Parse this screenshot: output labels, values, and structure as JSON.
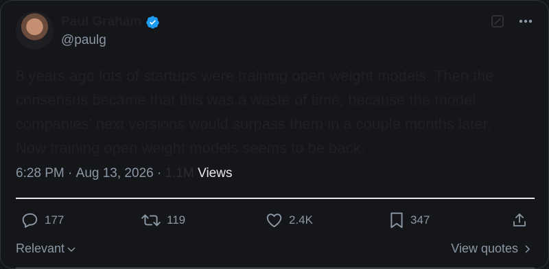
{
  "author": {
    "display_name": "Paul Graham",
    "handle": "@paulg"
  },
  "tweet": {
    "text": "8 years ago lots of startups were training open weight models. Then the consensus became that this was a waste of time, because the model companies' next versions would surpass them in a couple months later. Now training open weight models seems to be back."
  },
  "meta": {
    "time": "6:28 PM",
    "sep1": " · ",
    "date": "Aug 13, 2026",
    "sep2": " · ",
    "views_count": "1.1M",
    "views_label": " Views"
  },
  "actions": {
    "replies": "177",
    "reposts": "119",
    "likes": "2.4K",
    "bookmarks": "347"
  },
  "footer": {
    "relevant": "Relevant",
    "view_quotes": "View quotes"
  },
  "colors": {
    "background": "#15161a",
    "verified": "#1d9bf0",
    "muted_text": "#8b98a5",
    "primary_text": "#e7e9ea"
  },
  "icons": [
    "verified-badge-icon",
    "grok-icon",
    "more-icon",
    "reply-icon",
    "repost-icon",
    "like-icon",
    "bookmark-icon",
    "share-icon",
    "chevron-down-icon",
    "chevron-right-icon"
  ]
}
